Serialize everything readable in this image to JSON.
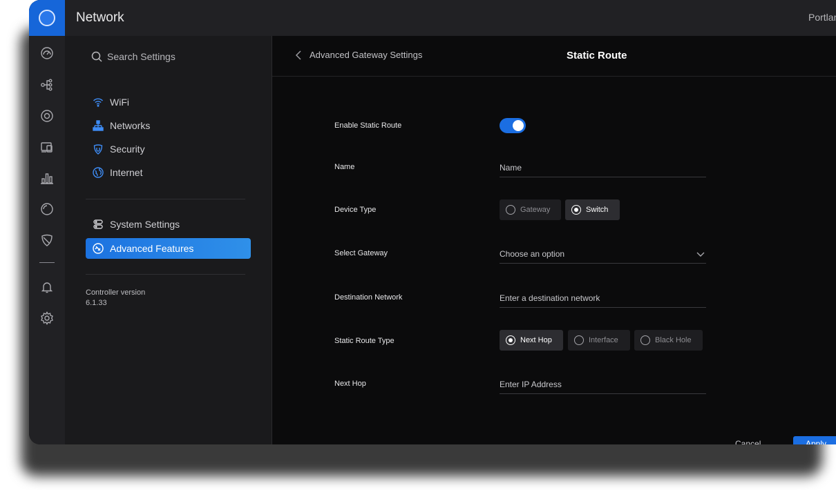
{
  "app": {
    "title": "Network",
    "site_name": "Portland"
  },
  "rail": {
    "items": [
      "dashboard-icon",
      "topology-icon",
      "devices-icon",
      "clients-icon",
      "statistics-icon",
      "insights-icon",
      "threat-management-icon",
      "alerts-icon",
      "settings-icon"
    ]
  },
  "settings_panel": {
    "search_placeholder": "Search Settings",
    "items": [
      {
        "label": "WiFi",
        "icon": "wifi-icon"
      },
      {
        "label": "Networks",
        "icon": "networks-icon"
      },
      {
        "label": "Security",
        "icon": "security-icon"
      },
      {
        "label": "Internet",
        "icon": "internet-icon"
      }
    ],
    "system_items": [
      {
        "label": "System Settings",
        "icon": "system-settings-icon"
      },
      {
        "label": "Advanced Features",
        "icon": "advanced-features-icon",
        "active": true
      }
    ],
    "controller_label": "Controller version",
    "controller_version": "6.1.33"
  },
  "content": {
    "back_label": "Advanced Gateway Settings",
    "title": "Static Route",
    "form": {
      "enable_label": "Enable Static Route",
      "enabled": true,
      "name_label": "Name",
      "name_placeholder": "Name",
      "device_type_label": "Device Type",
      "device_type_options": [
        "Gateway",
        "Switch"
      ],
      "device_type_selected": "Switch",
      "gateway_label": "Select Gateway",
      "gateway_placeholder": "Choose an option",
      "destination_label": "Destination Network",
      "destination_placeholder": "Enter a destination network",
      "route_type_label": "Static Route Type",
      "route_type_options": [
        "Next Hop",
        "Interface",
        "Black Hole"
      ],
      "route_type_selected": "Next Hop",
      "next_hop_label": "Next Hop",
      "next_hop_placeholder": "Enter IP Address"
    },
    "footer": {
      "cancel_label": "Cancel",
      "apply_label": "Apply"
    }
  },
  "colors": {
    "accent": "#1b6ee2",
    "background": "#0b0b0c",
    "panel": "#1a1a1c",
    "topbar": "#212124"
  }
}
